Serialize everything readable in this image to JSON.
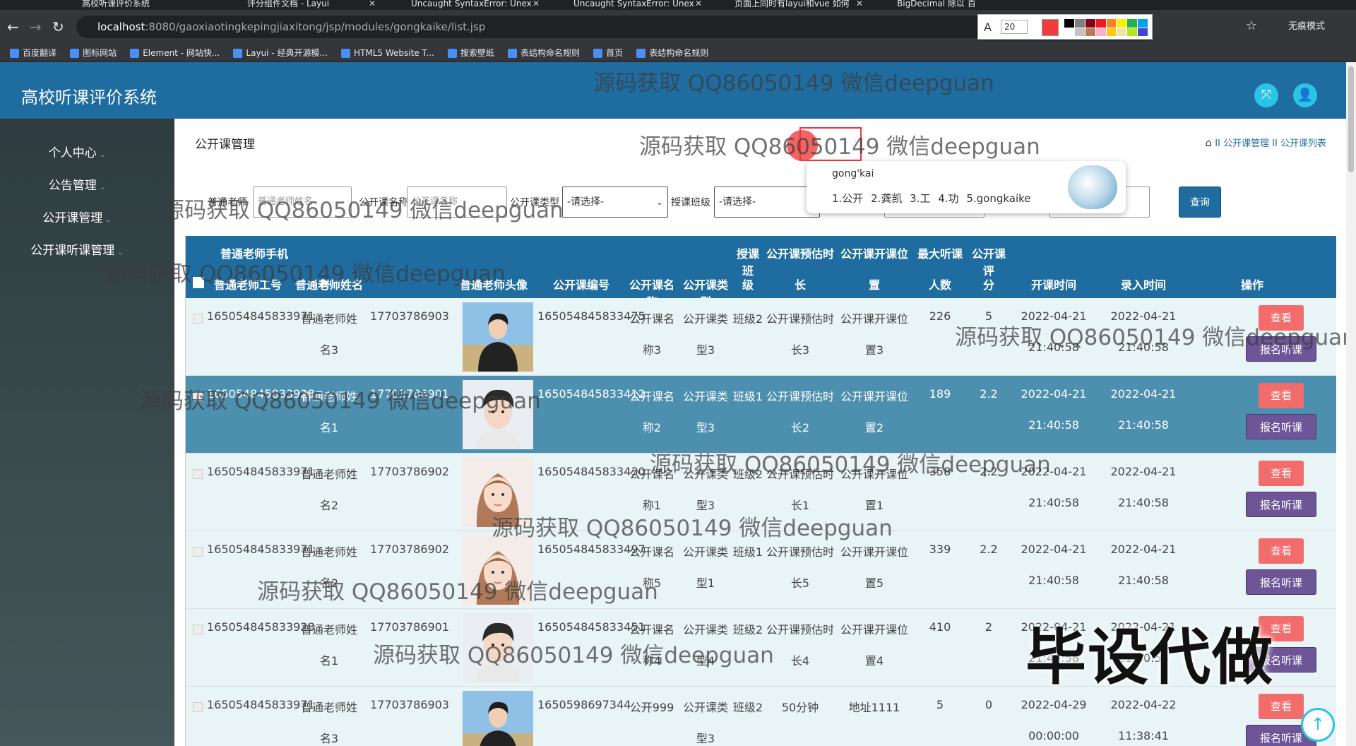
{
  "browser": {
    "tabs": [
      {
        "title": "高校听课评价系统"
      },
      {
        "title": "评分组件文档 - Layui"
      },
      {
        "title": "Uncaught SyntaxError: Unex"
      },
      {
        "title": "Uncaught SyntaxError: Unex"
      },
      {
        "title": "页面上同时有layui和vue 如何"
      },
      {
        "title": "BigDecimal 除以 百"
      }
    ],
    "url_host": "localhost",
    "url_path": ":8080/gaoxiaotingkepingjiaxitong/jsp/modules/gongkaike/list.jsp",
    "incognito_label": "无痕模式",
    "bookmarks": [
      "百度翻译",
      "图标网站",
      "Element - 网站快...",
      "Layui - 经典开源模...",
      "HTML5 Website T...",
      "搜索壁纸",
      "表结构命名规则",
      "首页",
      "表结构命名规则"
    ]
  },
  "snap_toolbar": {
    "font_size": "20",
    "current_color": "#f23b3b",
    "palette": [
      "#000000",
      "#7f7f7f",
      "#880015",
      "#ed1c24",
      "#ff7f27",
      "#fff200",
      "#22b14c",
      "#00a2e8",
      "#ffffff",
      "#c3c3c3",
      "#b97a57",
      "#ffaec9",
      "#ffc90e",
      "#efe4b0",
      "#b5e61d",
      "#3f48cc"
    ]
  },
  "app": {
    "title": "高校听课评价系统",
    "sidebar": [
      {
        "label": "个人中心"
      },
      {
        "label": "公告管理"
      },
      {
        "label": "公开课管理"
      },
      {
        "label": "公开课听课管理"
      }
    ],
    "page_title": "公开课管理",
    "breadcrumb": [
      "公开课管理",
      "公开课列表"
    ],
    "breadcrumb_sep": "II"
  },
  "search": {
    "field1_label": "普通老师",
    "field1_placeholder": "普通老师姓名",
    "field2_label": "公开课名称",
    "field2_placeholder": "公开课名称",
    "field3_label": "公开课类型",
    "field3_value": "-请选择-",
    "field4_label": "授课班级",
    "field4_value": "-请选择-",
    "button": "查询"
  },
  "ime": {
    "composition": "gong'kai",
    "candidates": "1.公开 2.龚凯 3.工 4.功 5.gongkaike"
  },
  "table": {
    "headers": [
      {
        "l1": "",
        "l2": "普通老师工号"
      },
      {
        "l1": "",
        "l2": "普通老师姓名"
      },
      {
        "l1": "普通老师手机",
        "l2": "号"
      },
      {
        "l1": "",
        "l2": "普通老师头像"
      },
      {
        "l1": "",
        "l2": "公开课编号"
      },
      {
        "l1": "",
        "l2": "公开课名称"
      },
      {
        "l1": "",
        "l2": "公开课类型"
      },
      {
        "l1": "授课班",
        "l2": "级"
      },
      {
        "l1": "公开课预估时",
        "l2": "长"
      },
      {
        "l1": "公开课开课位",
        "l2": "置"
      },
      {
        "l1": "最大听课",
        "l2": "人数"
      },
      {
        "l1": "公开课评",
        "l2": "分"
      },
      {
        "l1": "",
        "l2": "开课时间"
      },
      {
        "l1": "",
        "l2": "录入时间"
      },
      {
        "l1": "",
        "l2": "操作"
      }
    ],
    "view_label": "查看",
    "register_label": "报名听课",
    "rows": [
      {
        "worker_no": "165054845833971",
        "name_a": "普通老师姓",
        "name_b": "名3",
        "phone": "17703786903",
        "code": "165054845833475",
        "cname_a": "公开课名",
        "cname_b": "称3",
        "ctype_a": "公开课类",
        "ctype_b": "型3",
        "cls": "班级2",
        "dur_a": "公开课预估时",
        "dur_b": "长3",
        "loc_a": "公开课开课位",
        "loc_b": "置3",
        "max": "226",
        "score": "5",
        "start_a": "2022-04-21",
        "start_b": "21:40:58",
        "rec_a": "2022-04-21",
        "rec_b": "21:40:58",
        "avatar": "male-jacket"
      },
      {
        "worker_no": "165054845833928",
        "name_a": "普通老师姓",
        "name_b": "名1",
        "phone": "17703786901",
        "code": "165054845833412",
        "cname_a": "公开课名",
        "cname_b": "称2",
        "ctype_a": "公开课类",
        "ctype_b": "型3",
        "cls": "班级1",
        "dur_a": "公开课预估时",
        "dur_b": "长2",
        "loc_a": "公开课开课位",
        "loc_b": "置2",
        "max": "189",
        "score": "2.2",
        "start_a": "2022-04-21",
        "start_b": "21:40:58",
        "rec_a": "2022-04-21",
        "rec_b": "21:40:58",
        "avatar": "male-portrait"
      },
      {
        "worker_no": "165054845833971",
        "name_a": "普通老师姓",
        "name_b": "名2",
        "phone": "17703786902",
        "code": "165054845833430",
        "cname_a": "公开课名",
        "cname_b": "称1",
        "ctype_a": "公开课类",
        "ctype_b": "型3",
        "cls": "班级2",
        "dur_a": "公开课预估时",
        "dur_b": "长1",
        "loc_a": "公开课开课位",
        "loc_b": "置1",
        "max": "358",
        "score": "2.2",
        "start_a": "2022-04-21",
        "start_b": "21:40:58",
        "rec_a": "2022-04-21",
        "rec_b": "21:40:58",
        "avatar": "female-illustration"
      },
      {
        "worker_no": "165054845833971",
        "name_a": "普通老师姓",
        "name_b": "名2",
        "phone": "17703786902",
        "code": "165054845833497",
        "cname_a": "公开课名",
        "cname_b": "称5",
        "ctype_a": "公开课类",
        "ctype_b": "型1",
        "cls": "班级1",
        "dur_a": "公开课预估时",
        "dur_b": "长5",
        "loc_a": "公开课开课位",
        "loc_b": "置5",
        "max": "339",
        "score": "2.2",
        "start_a": "2022-04-21",
        "start_b": "21:40:58",
        "rec_a": "2022-04-21",
        "rec_b": "21:40:58",
        "avatar": "female-illustration"
      },
      {
        "worker_no": "165054845833928",
        "name_a": "普通老师姓",
        "name_b": "名1",
        "phone": "17703786901",
        "code": "165054845833451",
        "cname_a": "公开课名",
        "cname_b": "称4",
        "ctype_a": "公开课类",
        "ctype_b": "型4",
        "cls": "班级2",
        "dur_a": "公开课预估时",
        "dur_b": "长4",
        "loc_a": "公开课开课位",
        "loc_b": "置4",
        "max": "410",
        "score": "2",
        "start_a": "2022-04-21",
        "start_b": "21:40:58",
        "rec_a": "2022-04-21",
        "rec_b": "21:40:58",
        "avatar": "male-portrait"
      },
      {
        "worker_no": "165054845833971",
        "name_a": "普通老师姓",
        "name_b": "名3",
        "phone": "17703786903",
        "code": "1650598697344",
        "cname_a": "公开999",
        "cname_b": "",
        "ctype_a": "公开课类",
        "ctype_b": "型3",
        "cls": "班级2",
        "dur_a": "50分钟",
        "dur_b": "",
        "loc_a": "地址1111",
        "loc_b": "",
        "max": "5",
        "score": "0",
        "start_a": "2022-04-29",
        "start_b": "00:00:00",
        "rec_a": "2022-04-22",
        "rec_b": "11:38:41",
        "avatar": "male-jacket"
      }
    ]
  },
  "watermark": {
    "text": "源码获取 QQ86050149 微信deepguan",
    "big_text": "毕设代做"
  },
  "colors": {
    "header": "#1f6da0",
    "view_button": "#f26c6c",
    "register_button": "#6e5597",
    "accent": "#2ac4e6"
  }
}
